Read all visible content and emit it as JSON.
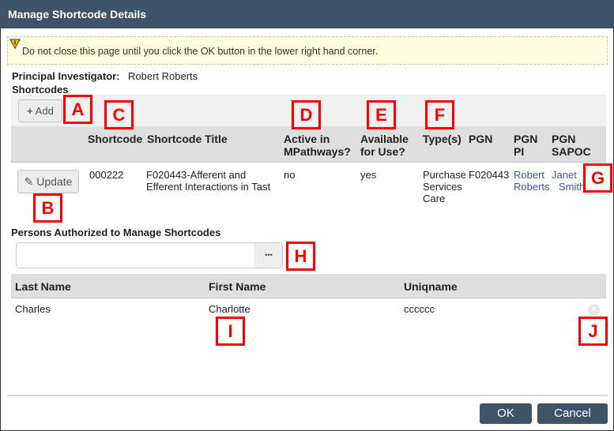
{
  "window": {
    "title": "Manage Shortcode Details"
  },
  "warning": {
    "icon": "warning-icon",
    "text": "Do not close this page until you click the OK button in the lower right hand corner."
  },
  "pi": {
    "label": "Principal Investigator:",
    "value": "Robert Roberts"
  },
  "shortcodes": {
    "heading": "Shortcodes",
    "add_label": "Add",
    "columns": [
      "Shortcode",
      "Shortcode Title",
      "Active in MPathways?",
      "Available for Use?",
      "Type(s)",
      "PGN",
      "PGN PI",
      "PGN SAPOC"
    ],
    "rows": [
      {
        "update_label": "Update",
        "shortcode": "000222",
        "title": "F020443-Afferent and Efferent Interactions in Tast",
        "active": "no",
        "available": "yes",
        "types": [
          "Purchase",
          "Services",
          "Care"
        ],
        "pgn": "F020443",
        "pgn_pi": [
          "Robert",
          "Roberts"
        ],
        "pgn_sapoc": [
          "Janet",
          "Smith"
        ]
      }
    ]
  },
  "persons": {
    "heading": "Persons Authorized to Manage Shortcodes",
    "input_value": "",
    "browse_label": "•••",
    "columns": [
      "Last Name",
      "First Name",
      "Uniqname"
    ],
    "rows": [
      {
        "last": "Charles",
        "first": "Charlotte",
        "uniqname": "cccccc"
      }
    ]
  },
  "footer": {
    "ok": "OK",
    "cancel": "Cancel"
  },
  "callouts": [
    "A",
    "B",
    "C",
    "D",
    "E",
    "F",
    "G",
    "H",
    "I",
    "J"
  ],
  "colors": {
    "titlebar": "#3d5468",
    "callout": "#ff0000",
    "link": "#3a5a8a"
  }
}
